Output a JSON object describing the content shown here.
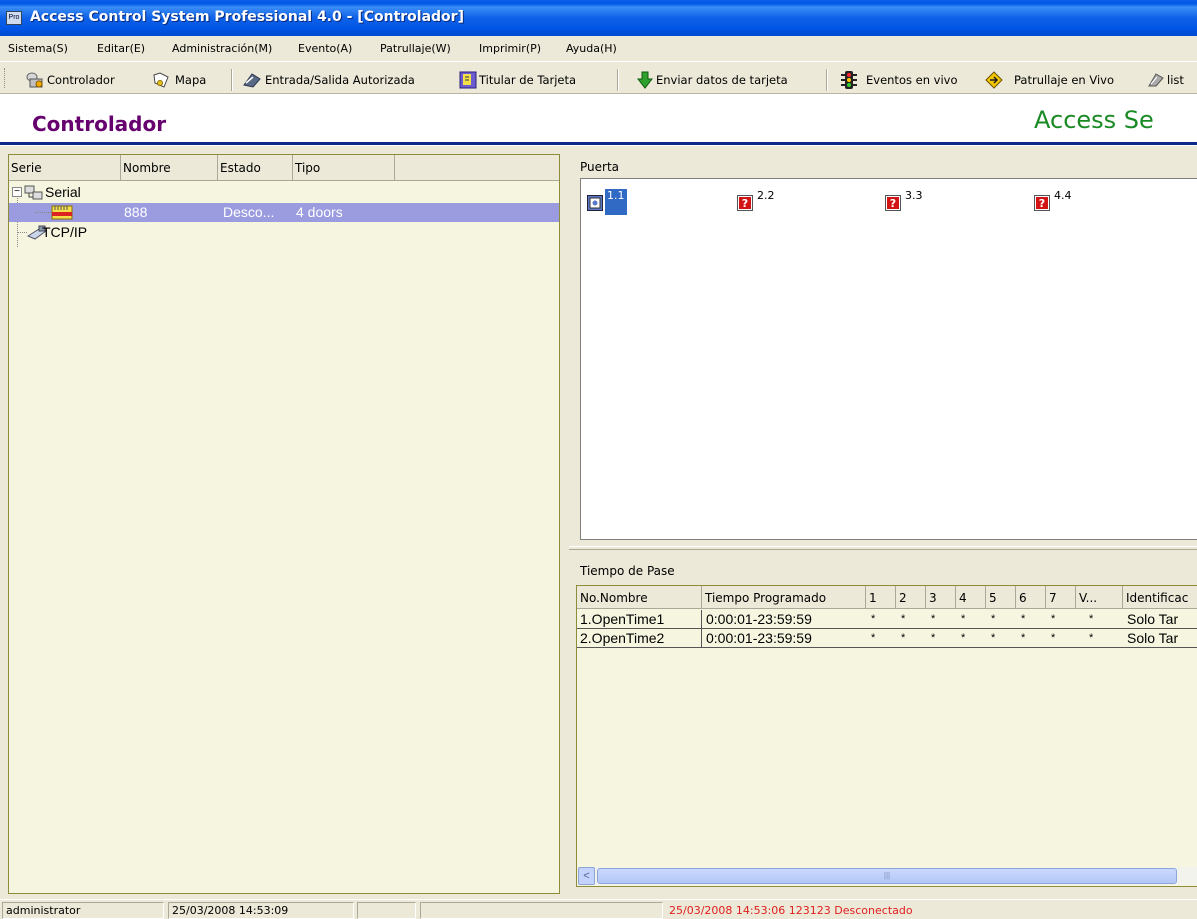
{
  "window": {
    "title": "Access Control System Professional 4.0 - [Controlador]",
    "app_icon_text": "Pro"
  },
  "menu": [
    {
      "label": "Sistema(S)"
    },
    {
      "label": "Editar(E)"
    },
    {
      "label": "Administración(M)"
    },
    {
      "label": "Evento(A)"
    },
    {
      "label": "Patrullaje(W)"
    },
    {
      "label": "Imprimir(P)"
    },
    {
      "label": "Ayuda(H)"
    }
  ],
  "toolbar": {
    "items": [
      {
        "label": "Controlador",
        "icon": "controller-icon"
      },
      {
        "label": "Mapa",
        "icon": "map-icon"
      },
      {
        "label": "Entrada/Salida Autorizada",
        "icon": "authorized-access-icon"
      },
      {
        "label": "Titular de Tarjeta",
        "icon": "cardholder-icon"
      },
      {
        "label": "Enviar datos de tarjeta",
        "icon": "send-down-arrow-icon"
      },
      {
        "label": "Eventos en vivo",
        "icon": "traffic-light-icon"
      },
      {
        "label": "Patrullaje en Vivo",
        "icon": "patrol-sign-icon"
      },
      {
        "label": "list",
        "icon": "list-icon"
      }
    ]
  },
  "header": {
    "page_title": "Controlador",
    "brand": "Access Se",
    "colors": {
      "title": "#66006e",
      "brand": "#1a8a25",
      "rule": "#0b2a8a"
    }
  },
  "tree": {
    "columns": [
      "Serie",
      "Nombre",
      "Estado",
      "Tipo"
    ],
    "nodes": [
      {
        "label": "Serial",
        "expander": "−",
        "icon": "serial-network-icon"
      },
      {
        "name": "888",
        "status": "Desco...",
        "type": "4 doors",
        "icon": "controller-device-icon",
        "selected": true
      },
      {
        "label": "TCP/IP",
        "icon": "tcpip-network-icon"
      }
    ]
  },
  "doors": {
    "label": "Puerta",
    "items": [
      {
        "label": "1.1",
        "icon": "door-active-icon",
        "active": true
      },
      {
        "label": "2.2",
        "icon": "door-unknown-icon"
      },
      {
        "label": "3.3",
        "icon": "door-unknown-icon"
      },
      {
        "label": "4.4",
        "icon": "door-unknown-icon"
      }
    ]
  },
  "schedule": {
    "label": "Tiempo de Pase",
    "columns": [
      "No.Nombre",
      "Tiempo Programado",
      "1",
      "2",
      "3",
      "4",
      "5",
      "6",
      "7",
      "V...",
      "Identificac"
    ],
    "rows": [
      {
        "name": "1.OpenTime1",
        "time": "0:00:01-23:59:59",
        "days": [
          "*",
          "*",
          "*",
          "*",
          "*",
          "*",
          "*",
          "*"
        ],
        "id": "Solo Tar"
      },
      {
        "name": "2.OpenTime2",
        "time": "0:00:01-23:59:59",
        "days": [
          "*",
          "*",
          "*",
          "*",
          "*",
          "*",
          "*",
          "*"
        ],
        "id": "Solo Tar"
      }
    ]
  },
  "scrollbar": {
    "left_arrow": "<",
    "grip": "|||"
  },
  "status": {
    "user": "administrator",
    "datetime": "25/03/2008 14:53:09",
    "event": "25/03/2008 14:53:06  123123  Desconectado",
    "event_color": "#e02020"
  }
}
